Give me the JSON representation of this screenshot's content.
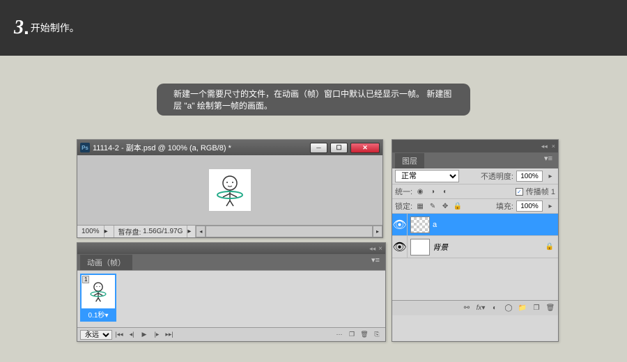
{
  "header": {
    "step_number": "3",
    "step_dot": ".",
    "step_text": "开始制作。"
  },
  "caption": "新建一个需要尺寸的文件，在动画（帧）窗口中默认已经显示一帧。 新建图层 \"a\" 绘制第一帧的画面。",
  "doc_window": {
    "title": "11114-2 - 副本.psd @ 100% (a, RGB/8) *",
    "zoom": "100%",
    "scratch_label": "暂存盘:",
    "scratch_value": "1.56G/1.97G"
  },
  "timeline": {
    "tab": "动画（帧）",
    "frame_number": "1",
    "frame_delay": "0.1秒",
    "loop_mode": "永远"
  },
  "layers": {
    "tab": "图层",
    "blend_mode": "正常",
    "opacity_label": "不透明度:",
    "opacity_value": "100%",
    "unify_label": "统一:",
    "propagate_label": "传播帧 1",
    "lock_label": "锁定:",
    "fill_label": "填充:",
    "fill_value": "100%",
    "items": [
      {
        "name": "a",
        "selected": true,
        "locked": false
      },
      {
        "name": "背景",
        "selected": false,
        "locked": true
      }
    ]
  }
}
